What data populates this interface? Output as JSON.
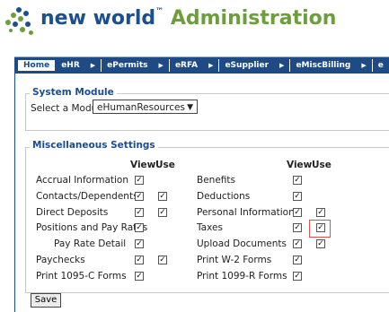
{
  "header": {
    "brand_name": "new world",
    "trademark": "™",
    "section_title": "Administration",
    "colors": {
      "brand_blue": "#1b4f8f",
      "admin_green": "#6d9e3c",
      "nav_blue": "#1e4a86"
    }
  },
  "nav": {
    "items": [
      {
        "label": "Home"
      },
      {
        "label": "eHR"
      },
      {
        "label": "ePermits"
      },
      {
        "label": "eRFA"
      },
      {
        "label": "eSupplier"
      },
      {
        "label": "eMiscBilling"
      },
      {
        "label": "e"
      }
    ]
  },
  "system_module": {
    "legend": "System Module",
    "select_label": "Select a Module",
    "selected_module": "eHumanResources"
  },
  "misc_settings": {
    "legend": "Miscellaneous Settings",
    "col_view": "View",
    "col_use": "Use",
    "left": [
      {
        "label": "Accrual Information",
        "view": true,
        "use": null
      },
      {
        "label": "Contacts/Dependents",
        "view": true,
        "use": true
      },
      {
        "label": "Direct Deposits",
        "view": true,
        "use": true
      },
      {
        "label": "Positions and Pay Rates",
        "view": true,
        "use": null
      },
      {
        "label": "Pay Rate Detail",
        "view": true,
        "use": null
      },
      {
        "label": "Paychecks",
        "view": true,
        "use": true
      },
      {
        "label": "Print 1095-C Forms",
        "view": true,
        "use": null
      }
    ],
    "right": [
      {
        "label": "Benefits",
        "view": true,
        "use": null
      },
      {
        "label": "Deductions",
        "view": true,
        "use": null
      },
      {
        "label": "Personal Information",
        "view": true,
        "use": true
      },
      {
        "label": "Taxes",
        "view": true,
        "use": true
      },
      {
        "label": "Upload Documents",
        "view": true,
        "use": true
      },
      {
        "label": "Print W-2 Forms",
        "view": true,
        "use": null
      },
      {
        "label": "Print 1099-R Forms",
        "view": true,
        "use": null
      }
    ]
  },
  "save_label": "Save"
}
